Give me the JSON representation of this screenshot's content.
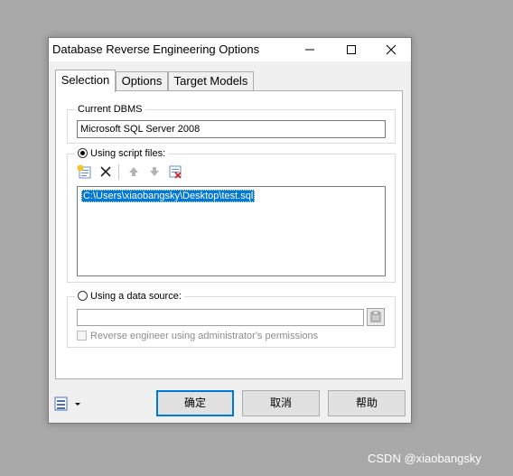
{
  "window": {
    "title": "Database Reverse Engineering Options"
  },
  "tabs": [
    {
      "label": "Selection",
      "active": true
    },
    {
      "label": "Options",
      "active": false
    },
    {
      "label": "Target Models",
      "active": false
    }
  ],
  "current_dbms": {
    "legend": "Current DBMS",
    "value": "Microsoft SQL Server 2008"
  },
  "script_files": {
    "label": "Using script files:",
    "selected": true,
    "toolbar": [
      "add-files-icon",
      "delete-icon",
      "move-up-icon",
      "move-down-icon",
      "clear-list-icon"
    ],
    "items": [
      "C:\\Users\\xiaobangsky\\Desktop\\test.sql"
    ]
  },
  "data_source": {
    "label": "Using a data source:",
    "selected": false,
    "value": "",
    "checkbox_label": "Reverse engineer using administrator's permissions",
    "checkbox_checked": false
  },
  "buttons": {
    "ok": "确定",
    "cancel": "取消",
    "help": "帮助"
  },
  "watermark": "CSDN @xiaobangsky",
  "colors": {
    "selection": "#0078d7",
    "background": "#a9a9a9",
    "dialog": "#f0f0f0"
  }
}
